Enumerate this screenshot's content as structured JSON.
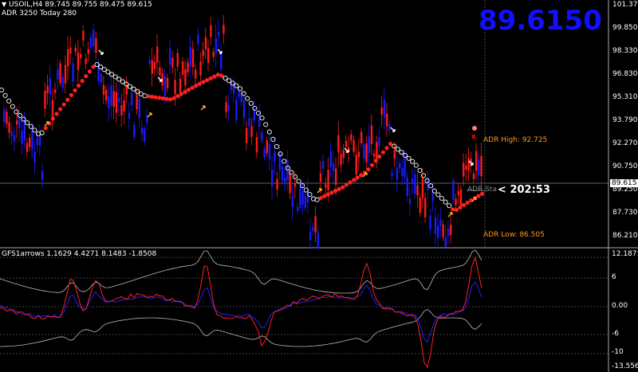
{
  "header": {
    "symbol_line": "USOIL,H4  89.745 89.755 89.475 89.615",
    "adr_line": "ADR 3250  Today 280"
  },
  "current_price_big": "89.6150",
  "current_price_tag": "89.615",
  "adr": {
    "high_label": "ADR High: 92.725",
    "low_label": "ADR Low: 86.505",
    "start_label": "ADR Sta"
  },
  "countdown": "202:53",
  "countdown_arrow": "<",
  "price_axis": [
    "101.370",
    "99.850",
    "98.330",
    "96.830",
    "95.310",
    "93.790",
    "92.270",
    "90.750",
    "89.250",
    "87.730",
    "86.210"
  ],
  "indicator": {
    "label": "GFS1arrows 1.1629 4.4271 8.1483 -1.8508",
    "axis": [
      "12.1871",
      "6",
      "0.00",
      "-6",
      "-10",
      "-13.5569"
    ]
  },
  "colors": {
    "bull_candle": "#ff1a1a",
    "bear_candle": "#1a1aff",
    "bull_dot": "#ff2020",
    "bear_dot": "#ffffff",
    "up_arrow": "#ffb020",
    "down_arrow": "#ffffff",
    "adr_text": "#ff9a1a",
    "big_price": "#1010ff"
  }
}
